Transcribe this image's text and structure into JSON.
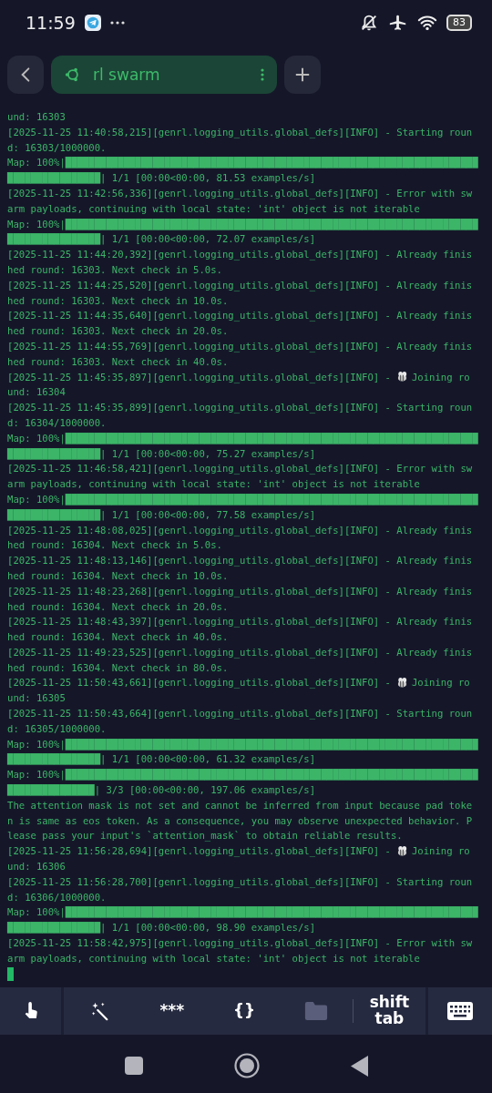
{
  "status_bar": {
    "time": "11:59",
    "battery": "83"
  },
  "tab": {
    "title": "rl swarm"
  },
  "terminal": {
    "lines": [
      {
        "kind": "text",
        "text": "und: 16303"
      },
      {
        "kind": "text",
        "text": "[2025-11-25 11:40:58,215][genrl.logging_utils.global_defs][INFO] - Starting roun"
      },
      {
        "kind": "text",
        "text": "d: 16303/1000000."
      },
      {
        "kind": "text",
        "text": "Map: 100%|███████████████████████████████████████████████████████████████████████"
      },
      {
        "kind": "text",
        "text": "████████████████| 1/1 [00:00<00:00, 81.53 examples/s]"
      },
      {
        "kind": "text",
        "text": "[2025-11-25 11:42:56,336][genrl.logging_utils.global_defs][INFO] - Error with sw"
      },
      {
        "kind": "text",
        "text": "arm payloads, continuing with local state: 'int' object is not iterable"
      },
      {
        "kind": "text",
        "text": "Map: 100%|███████████████████████████████████████████████████████████████████████"
      },
      {
        "kind": "text",
        "text": "████████████████| 1/1 [00:00<00:00, 72.07 examples/s]"
      },
      {
        "kind": "text",
        "text": "[2025-11-25 11:44:20,392][genrl.logging_utils.global_defs][INFO] - Already finis"
      },
      {
        "kind": "text",
        "text": "hed round: 16303. Next check in 5.0s."
      },
      {
        "kind": "text",
        "text": "[2025-11-25 11:44:25,520][genrl.logging_utils.global_defs][INFO] - Already finis"
      },
      {
        "kind": "text",
        "text": "hed round: 16303. Next check in 10.0s."
      },
      {
        "kind": "text",
        "text": "[2025-11-25 11:44:35,640][genrl.logging_utils.global_defs][INFO] - Already finis"
      },
      {
        "kind": "text",
        "text": "hed round: 16303. Next check in 20.0s."
      },
      {
        "kind": "text",
        "text": "[2025-11-25 11:44:55,769][genrl.logging_utils.global_defs][INFO] - Already finis"
      },
      {
        "kind": "text",
        "text": "hed round: 16303. Next check in 40.0s."
      },
      {
        "kind": "bee",
        "text": "[2025-11-25 11:45:35,897][genrl.logging_utils.global_defs][INFO] -",
        "after": "Joining ro"
      },
      {
        "kind": "text",
        "text": "und: 16304"
      },
      {
        "kind": "text",
        "text": "[2025-11-25 11:45:35,899][genrl.logging_utils.global_defs][INFO] - Starting roun"
      },
      {
        "kind": "text",
        "text": "d: 16304/1000000."
      },
      {
        "kind": "text",
        "text": "Map: 100%|███████████████████████████████████████████████████████████████████████"
      },
      {
        "kind": "text",
        "text": "████████████████| 1/1 [00:00<00:00, 75.27 examples/s]"
      },
      {
        "kind": "text",
        "text": "[2025-11-25 11:46:58,421][genrl.logging_utils.global_defs][INFO] - Error with sw"
      },
      {
        "kind": "text",
        "text": "arm payloads, continuing with local state: 'int' object is not iterable"
      },
      {
        "kind": "text",
        "text": "Map: 100%|███████████████████████████████████████████████████████████████████████"
      },
      {
        "kind": "text",
        "text": "████████████████| 1/1 [00:00<00:00, 77.58 examples/s]"
      },
      {
        "kind": "text",
        "text": "[2025-11-25 11:48:08,025][genrl.logging_utils.global_defs][INFO] - Already finis"
      },
      {
        "kind": "text",
        "text": "hed round: 16304. Next check in 5.0s."
      },
      {
        "kind": "text",
        "text": "[2025-11-25 11:48:13,146][genrl.logging_utils.global_defs][INFO] - Already finis"
      },
      {
        "kind": "text",
        "text": "hed round: 16304. Next check in 10.0s."
      },
      {
        "kind": "text",
        "text": "[2025-11-25 11:48:23,268][genrl.logging_utils.global_defs][INFO] - Already finis"
      },
      {
        "kind": "text",
        "text": "hed round: 16304. Next check in 20.0s."
      },
      {
        "kind": "text",
        "text": "[2025-11-25 11:48:43,397][genrl.logging_utils.global_defs][INFO] - Already finis"
      },
      {
        "kind": "text",
        "text": "hed round: 16304. Next check in 40.0s."
      },
      {
        "kind": "text",
        "text": "[2025-11-25 11:49:23,525][genrl.logging_utils.global_defs][INFO] - Already finis"
      },
      {
        "kind": "text",
        "text": "hed round: 16304. Next check in 80.0s."
      },
      {
        "kind": "bee",
        "text": "[2025-11-25 11:50:43,661][genrl.logging_utils.global_defs][INFO] -",
        "after": "Joining ro"
      },
      {
        "kind": "text",
        "text": "und: 16305"
      },
      {
        "kind": "text",
        "text": "[2025-11-25 11:50:43,664][genrl.logging_utils.global_defs][INFO] - Starting roun"
      },
      {
        "kind": "text",
        "text": "d: 16305/1000000."
      },
      {
        "kind": "text",
        "text": "Map: 100%|███████████████████████████████████████████████████████████████████████"
      },
      {
        "kind": "text",
        "text": "████████████████| 1/1 [00:00<00:00, 61.32 examples/s]"
      },
      {
        "kind": "text",
        "text": "Map: 100%|███████████████████████████████████████████████████████████████████████"
      },
      {
        "kind": "text",
        "text": "███████████████| 3/3 [00:00<00:00, 197.06 examples/s]"
      },
      {
        "kind": "text",
        "text": "The attention mask is not set and cannot be inferred from input because pad toke"
      },
      {
        "kind": "text",
        "text": "n is same as eos token. As a consequence, you may observe unexpected behavior. P"
      },
      {
        "kind": "text",
        "text": "lease pass your input's `attention_mask` to obtain reliable results."
      },
      {
        "kind": "bee",
        "text": "[2025-11-25 11:56:28,694][genrl.logging_utils.global_defs][INFO] -",
        "after": "Joining ro"
      },
      {
        "kind": "text",
        "text": "und: 16306"
      },
      {
        "kind": "text",
        "text": "[2025-11-25 11:56:28,700][genrl.logging_utils.global_defs][INFO] - Starting roun"
      },
      {
        "kind": "text",
        "text": "d: 16306/1000000."
      },
      {
        "kind": "text",
        "text": "Map: 100%|███████████████████████████████████████████████████████████████████████"
      },
      {
        "kind": "text",
        "text": "████████████████| 1/1 [00:00<00:00, 98.90 examples/s]"
      },
      {
        "kind": "text",
        "text": "[2025-11-25 11:58:42,975][genrl.logging_utils.global_defs][INFO] - Error with sw"
      },
      {
        "kind": "text",
        "text": "arm payloads, continuing with local state: 'int' object is not iterable"
      },
      {
        "kind": "cursor"
      }
    ]
  },
  "extra_keys": [
    {
      "kind": "touch"
    },
    {
      "kind": "wand"
    },
    {
      "kind": "text",
      "label": "***"
    },
    {
      "kind": "text",
      "label": "{}"
    },
    {
      "kind": "folder"
    },
    {
      "kind": "text",
      "label": "shift tab"
    },
    {
      "kind": "keyboard"
    }
  ]
}
